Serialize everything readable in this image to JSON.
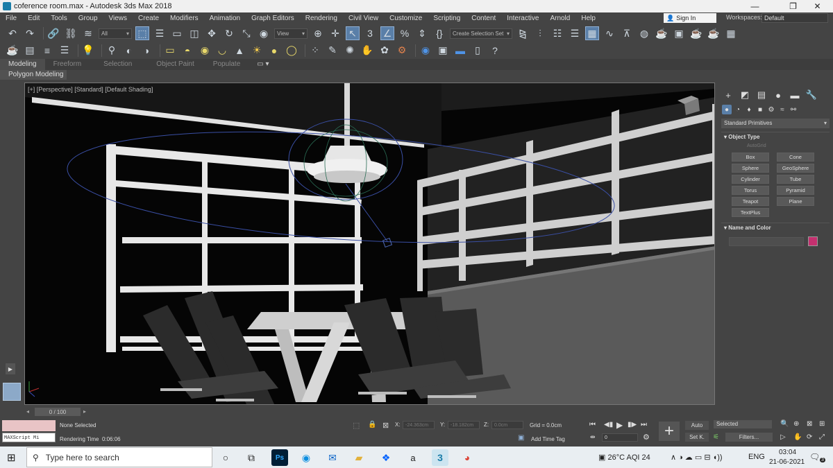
{
  "window": {
    "title": "coference room.max - Autodesk 3ds Max 2018",
    "minimize": "—",
    "restore": "❐",
    "close": "✕"
  },
  "menu": [
    "File",
    "Edit",
    "Tools",
    "Group",
    "Views",
    "Create",
    "Modifiers",
    "Animation",
    "Graph Editors",
    "Rendering",
    "Civil View",
    "Customize",
    "Scripting",
    "Content",
    "Interactive",
    "Arnold",
    "Help"
  ],
  "account": {
    "signin": "Sign In",
    "workspaces_label": "Workspaces:",
    "workspace": "Default"
  },
  "toolbar": {
    "filter": "All",
    "ref_coord": "View",
    "selection_set": "Create Selection Set"
  },
  "ribbon": {
    "tabs": [
      "Modeling",
      "Freeform",
      "Selection",
      "Object Paint",
      "Populate"
    ],
    "active_tab": "Modeling",
    "panel": "Polygon Modeling"
  },
  "viewport": {
    "label": "[+] [Perspective] [Standard] [Default Shading]"
  },
  "command_panel": {
    "tabs": [
      "+",
      "◩",
      "▤",
      "●",
      "▬",
      "🔧"
    ],
    "dropdown": "Standard Primitives",
    "object_type_title": "Object Type",
    "autogrid": "AutoGrid",
    "objects": [
      "Box",
      "Cone",
      "Sphere",
      "GeoSphere",
      "Cylinder",
      "Tube",
      "Torus",
      "Pyramid",
      "Teapot",
      "Plane",
      "TextPlus"
    ],
    "name_color_title": "Name and Color",
    "object_color": "#c4306f"
  },
  "timeline": {
    "frame": "0 / 100"
  },
  "status": {
    "maxscript": "MAXScript Mi",
    "selection": "None Selected",
    "rendering_time_label": "Rendering Time",
    "rendering_time": "0:06:06",
    "x_label": "X:",
    "x_value": "-24.363cm",
    "y_label": "Y:",
    "y_value": "-18.182cm",
    "z_label": "Z:",
    "z_value": "0.0cm",
    "grid": "Grid = 0.0cm",
    "add_time_tag": "Add Time Tag",
    "auto_key": "Auto",
    "set_key": "Set K.",
    "key_filter_mode": "Selected",
    "filters": "Filters...",
    "frame_field": "0"
  },
  "taskbar": {
    "search_placeholder": "Type here to search",
    "weather": "26°C  AQI 24",
    "language": "ENG",
    "time": "03:04",
    "date": "21-06-2021",
    "notifications": "3"
  },
  "colors": {
    "ui_bg": "#444444",
    "viewport_bg": "#050505",
    "active_tool": "#5a7fa8",
    "windows_taskbar": "#e9eef2"
  }
}
